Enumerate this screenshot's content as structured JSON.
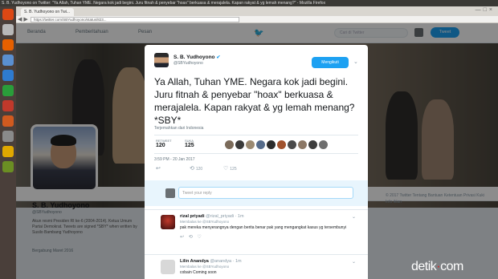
{
  "window": {
    "os_title": "S. B. Yudhoyono on Twitter: \"Ya Allah, Tuhan YME. Negara kok jadi begini. Juru fitnah & penyebar \"hoax\" berkuasa & merajalela. Kapan rakyat & yg lemah menang?\" - Mozilla Firefox",
    "tab_title": "S. B. Yudhoyono on Twi...",
    "url": "https://twitter.com/SBYudhoyono/status/823..."
  },
  "nav": {
    "home": "Beranda",
    "notifications": "Pemberitahuan",
    "messages": "Pesan",
    "search_placeholder": "Cari di Twitter",
    "tweet_button": "Tweet"
  },
  "profile": {
    "name": "S. B. Yudhoyono",
    "handle": "@SBYudhoyono",
    "bio": "Akun resmi Presiden RI ke-6 (2004-2014). Ketua Umum Partai Demokrat. Tweets are signed *SBY* when written by Susilo Bambang Yudhoyono",
    "joined": "Bergabung Maret 2016"
  },
  "footer": {
    "links": "© 2017 Twitter  Tentang  Bantuan  Ketentuan  Privasi  Kuki  Info iklan"
  },
  "tweet": {
    "author_name": "S. B. Yudhoyono",
    "verified_mark": "✔",
    "author_handle": "@SBYudhoyono",
    "follow_button": "Mengikuti",
    "text": "Ya Allah, Tuhan YME. Negara kok jadi begini. Juru fitnah & penyebar \"hoax\" berkuasa & merajalela. Kapan rakyat & yg lemah menang? *SBY*",
    "translate": "Terjemahkan dari Indonesia",
    "retweets_label": "RETWEET",
    "retweets": "120",
    "likes_label": "SUKA",
    "likes": "125",
    "timestamp": "3:59 PM - 20 Jan 2017",
    "reply_count": "",
    "retweet_count": "120",
    "like_count": "125"
  },
  "reply_box": {
    "placeholder": "Tweet your reply"
  },
  "replies": [
    {
      "name": "rizal priyadi",
      "handle": "@rizal_priyadi · 1m",
      "meta": "Membalas ke @SBYudhoyono",
      "text": "pak mereka menyerangnya dengan berita benar pak yang mengangkat kasus yg tersembunyi"
    },
    {
      "name": "Lilin Anandya",
      "handle": "@anandya · 1m",
      "meta": "Membalas ke @SBYudhoyono",
      "text": "cobain Coming soon"
    }
  ],
  "watermark": {
    "brand": "detik",
    "dot": "·",
    "tld": "com"
  },
  "colors": {
    "accent": "#1da1f2",
    "verified": "#1da1f2"
  },
  "icons": {
    "bird": "twitter-bird-icon",
    "chevron": "chevron-down-icon"
  }
}
